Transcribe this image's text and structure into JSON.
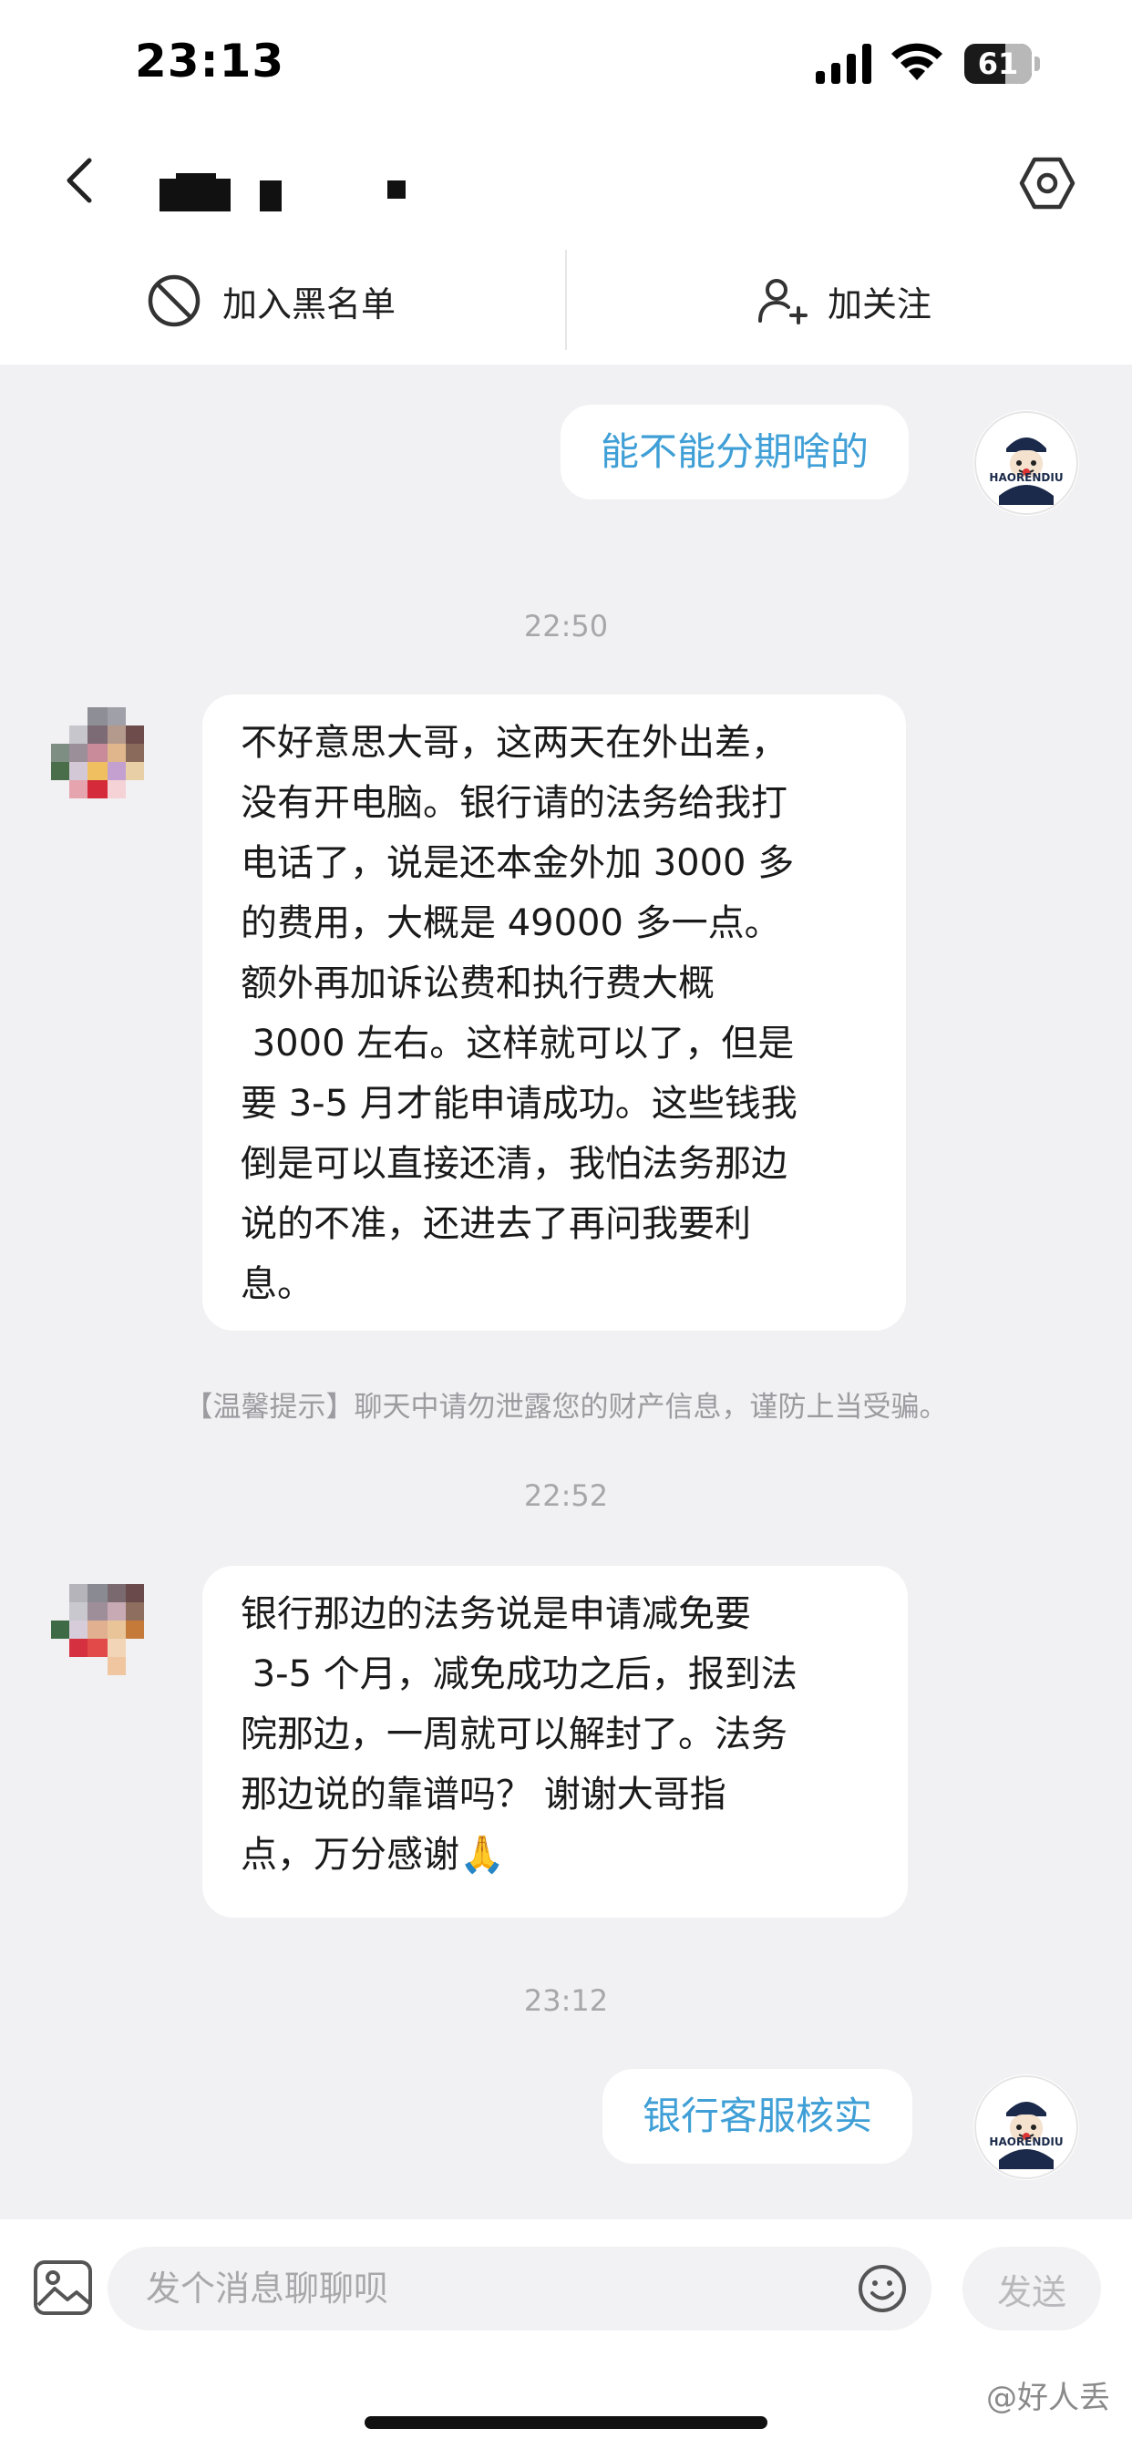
{
  "status_bar": {
    "time": "23:13",
    "battery": "61"
  },
  "header": {
    "back_icon": "chevron-left-icon",
    "settings_icon": "settings-hex-icon"
  },
  "actions": {
    "blacklist_label": "加入黑名单",
    "follow_label": "加关注"
  },
  "messages": [
    {
      "type": "outgoing",
      "text": "能不能分期啥的"
    },
    {
      "type": "time",
      "text": "22:50"
    },
    {
      "type": "incoming",
      "text": "不好意思大哥，这两天在外出差，\n没有开电脑。银行请的法务给我打\n电话了，说是还本金外加 3000 多\n的费用，大概是 49000 多一点。\n额外再加诉讼费和执行费大概\n 3000 左右。这样就可以了，但是\n要 3-5 月才能申请成功。这些钱我\n倒是可以直接还清，我怕法务那边\n说的不准，还进去了再问我要利\n息。"
    },
    {
      "type": "notice",
      "text": "【温馨提示】聊天中请勿泄露您的财产信息，谨防上当受骗。"
    },
    {
      "type": "time",
      "text": "22:52"
    },
    {
      "type": "incoming",
      "text": "银行那边的法务说是申请减免要\n 3-5 个月，减免成功之后，报到法\n院那边，一周就可以解封了。法务\n那边说的靠谱吗？ 谢谢大哥指\n点，万分感谢🙏"
    },
    {
      "type": "time",
      "text": "23:12"
    },
    {
      "type": "outgoing",
      "text": "银行客服核实"
    }
  ],
  "self_avatar_text": "HAORENDIU",
  "input": {
    "placeholder": "发个消息聊聊呗",
    "send_label": "发送"
  },
  "watermark": "@好人丢",
  "colors": {
    "chat_background": "#f1f1f3",
    "outgoing_text": "#3f9fd6"
  }
}
